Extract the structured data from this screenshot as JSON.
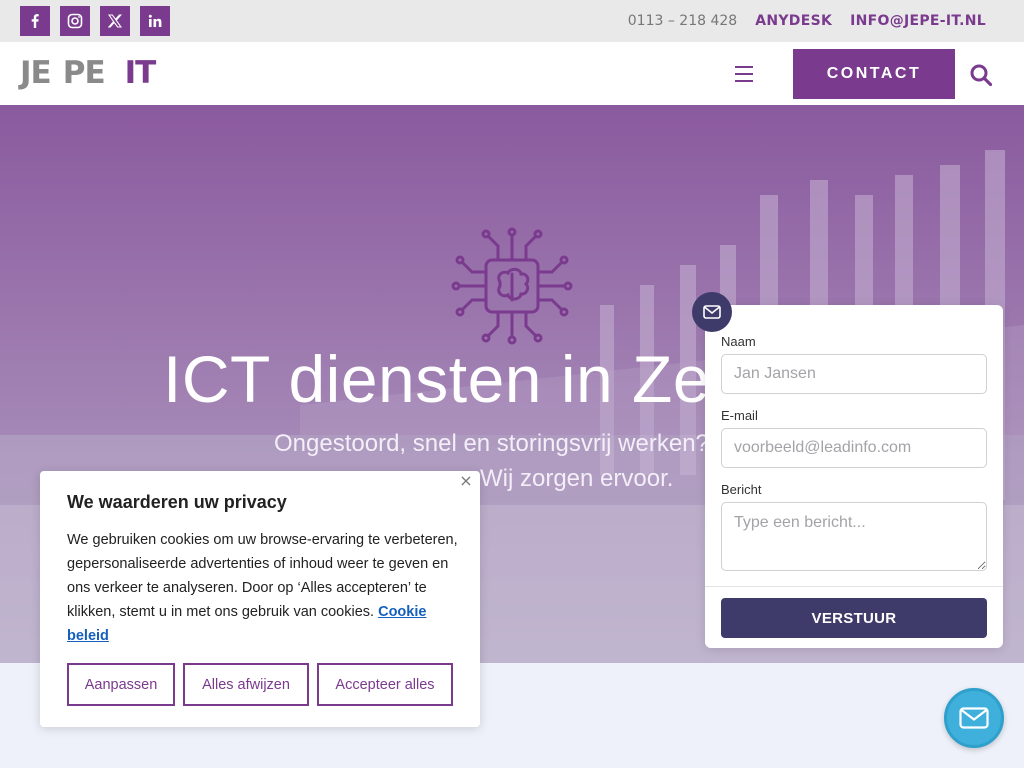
{
  "topbar": {
    "social": [
      {
        "name": "facebook-icon"
      },
      {
        "name": "instagram-icon"
      },
      {
        "name": "x-twitter-icon"
      },
      {
        "name": "linkedin-icon"
      }
    ],
    "phone": "0113 – 218 428",
    "anydesk": "ANYDESK",
    "email": "INFO@JEPE-IT.NL"
  },
  "header": {
    "logo": {
      "part1": "JE",
      "part2": "PE",
      "part3": "IT"
    },
    "contact_label": "CONTACT"
  },
  "hero": {
    "title": "ICT diensten in Zeeland",
    "subtitle_line1": "Ongestoord, snel en storingsvrij werken?",
    "subtitle_line2": "Wij zorgen ervoor."
  },
  "cookie": {
    "title": "We waarderen uw privacy",
    "text": "We gebruiken cookies om uw browse-ervaring te verbeteren, gepersonaliseerde advertenties of inhoud weer te geven en ons verkeer te analyseren. Door op ‘Alles accepteren’ te klikken, stemt u in met ons gebruik van cookies.",
    "link": "Cookie beleid",
    "close": "×",
    "buttons": {
      "customize": "Aanpassen",
      "reject": "Alles afwijzen",
      "accept": "Accepteer alles"
    }
  },
  "form": {
    "name_label": "Naam",
    "name_placeholder": "Jan Jansen",
    "email_label": "E-mail",
    "email_placeholder": "voorbeeld@leadinfo.com",
    "message_label": "Bericht",
    "message_placeholder": "Type een bericht...",
    "submit_label": "VERSTUUR"
  },
  "colors": {
    "brand_purple": "#7a3a8e",
    "form_dark": "#3e3a6a",
    "chat_blue": "#3fb0dc"
  }
}
